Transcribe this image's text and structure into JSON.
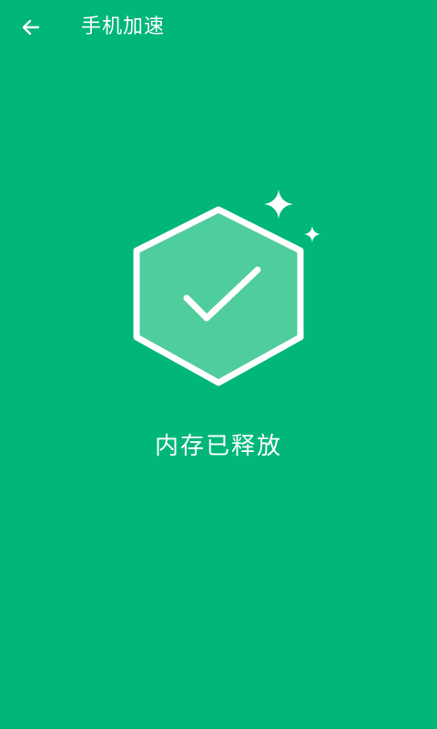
{
  "header": {
    "back_icon": "arrow-left-icon",
    "title": "手机加速"
  },
  "result": {
    "icons": [
      "hexagon-check-icon",
      "sparkle-icon"
    ],
    "message": "内存已释放"
  },
  "colors": {
    "background": "#00b679",
    "foreground": "#ffffff",
    "hexagon_fill": "#4fcd9c"
  }
}
